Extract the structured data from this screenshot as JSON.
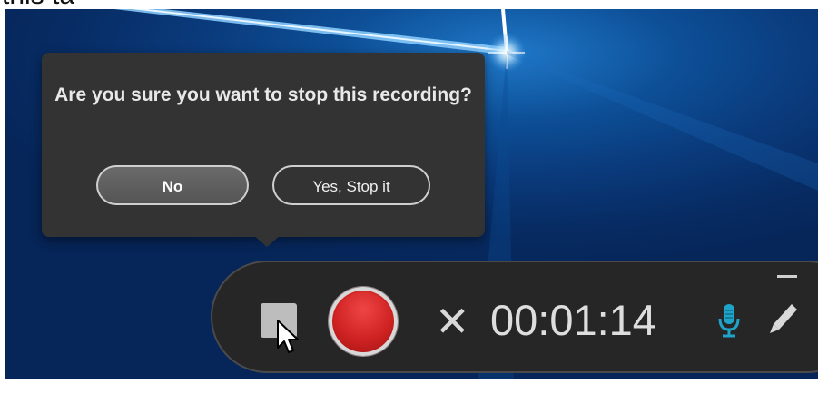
{
  "top_strip": {
    "cut_text": "this ta"
  },
  "popover": {
    "question": "Are you sure you want to stop this recording?",
    "no_label": "No",
    "yes_label": "Yes, Stop it"
  },
  "toolbar": {
    "timer": "00:01:14",
    "cancel_glyph": "✕",
    "icons": [
      "stop-icon",
      "record-icon",
      "cancel-icon",
      "microphone-icon",
      "pen-icon",
      "minimize-icon",
      "cursor-icon"
    ]
  },
  "colors": {
    "popover_bg": "#333333",
    "toolbar_bg": "#262626",
    "record_red": "#cf2222",
    "mic_blue": "#1fa3c8"
  }
}
